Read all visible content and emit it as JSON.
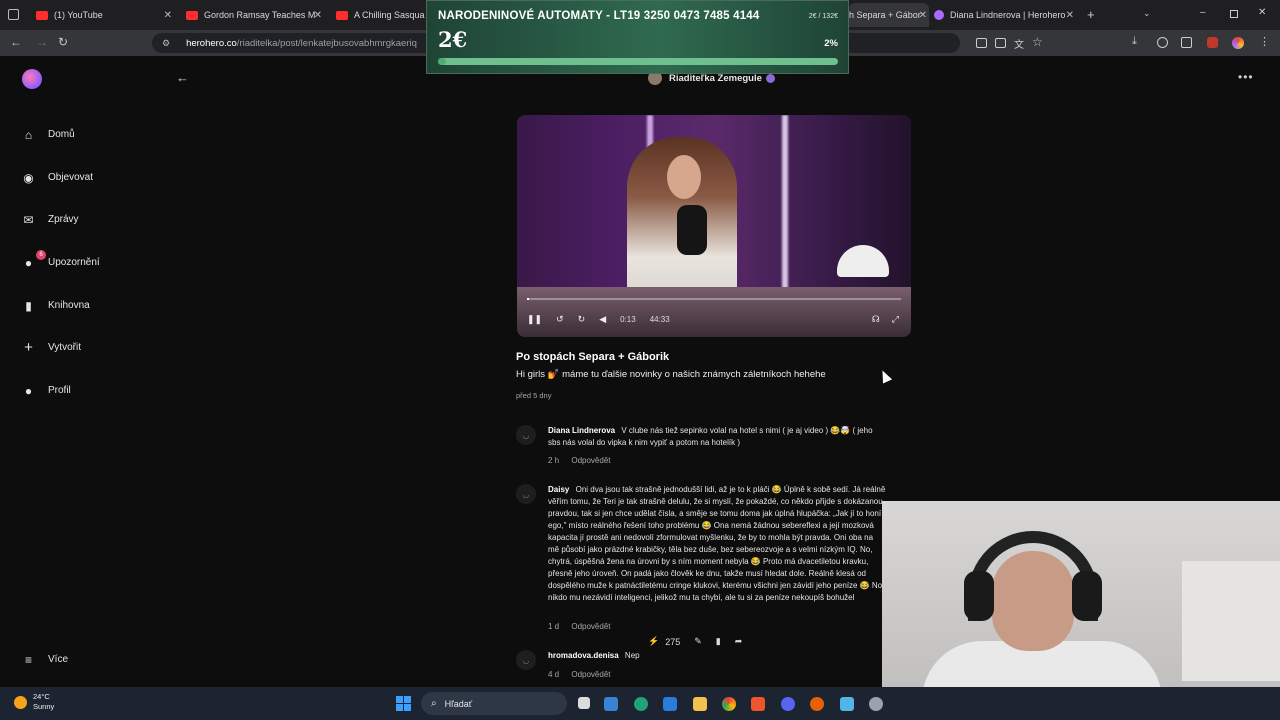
{
  "browser": {
    "tabs": [
      {
        "label": "(1) YouTube",
        "color": "#ff2d2d"
      },
      {
        "label": "Gordon Ramsay Teaches M",
        "color": "#ff2d2d"
      },
      {
        "label": "A Chilling Sasqua",
        "color": "#ff2d2d"
      },
      {
        "label": "h Separa + Gábor",
        "color": "#a86bff"
      },
      {
        "label": "Diana Lindnerova | Herohero",
        "color": "#a86bff"
      }
    ],
    "url_host": "herohero.co",
    "url_path": "/riaditelka/post/lenkatejbusovabhmrgkaeriq"
  },
  "banner": {
    "title": "NARODENINOVÉ AUTOMATY - LT19 3250 0473 7485 4144",
    "amount": "2€",
    "goal": "2€ / 132€",
    "percent_label": "2%",
    "percent": 2
  },
  "sidebar": {
    "items": [
      {
        "label": "Domů",
        "icon": "home-icon"
      },
      {
        "label": "Objevovat",
        "icon": "compass-icon"
      },
      {
        "label": "Zprávy",
        "icon": "mail-icon"
      },
      {
        "label": "Upozornění",
        "icon": "bell-icon",
        "badge": "6"
      },
      {
        "label": "Knihovna",
        "icon": "bookmark-icon"
      },
      {
        "label": "Vytvořit",
        "icon": "plus-icon"
      },
      {
        "label": "Profil",
        "icon": "user-icon"
      }
    ],
    "more": "Více"
  },
  "author": {
    "name": "Riaditeľka Zemegule"
  },
  "video": {
    "time": "0:13",
    "duration": "44:33",
    "progress": 0.005
  },
  "post": {
    "title": "Po stopách Separa + Gáborik",
    "text": "Hi girls 💅 máme tu ďalšie novinky o našich známych záletníkoch hehehe",
    "date": "před 5 dny"
  },
  "comments": [
    {
      "name": "Diana Lindnerova",
      "text": "V clube nás tiež sepinko volal na hotel s nimi ( je aj video ) 😂🤯 ( jeho sbs nás volal do vipka k nim vypiť a potom na hotelík )",
      "age": "2 h",
      "reply": "Odpovědět"
    },
    {
      "name": "Daisy",
      "text": "Oni dva jsou tak strašně jednodušší lidi, až je to k pláči 😂 Úplně k sobě sedí. Já reálně věřím tomu, že Teri je tak strašně delulu, že si myslí, že pokaždé, co někdo přijde s dokázanou pravdou, tak si jen chce udělat čísla, a směje se tomu doma jak úplná hlupáčka: „Jak jí to honí ego,\" místo reálného řešení toho problému 😂 Ona nemá žádnou sebereflexi a její mozková kapacita jí prostě ani nedovolí zformulovat myšlenku, že by to mohla být pravda. Oni oba na mě působí jako prázdné krabičky, těla bez duše, bez sebereozvoje a s velmi nízkým IQ. No, chytrá, úspěšná žena na úrovni by s ním moment nebyla 😂 Proto má dvacetiletou kravku, přesně jeho úroveň. On padá jako člověk ke dnu, takže musí hledat dole. Reálně klesá od dospělého muže k patnáctiletému cringe klukovi, kterému všichni jen závidí jeho peníze 😂 No, nikdo mu nezávidí inteligenci, jelikož mu ta chybí, ale tu si za peníze nekoupíš bohužel",
      "age": "1 d",
      "reply": "Odpovědět"
    },
    {
      "name": "hromadova.denisa",
      "text": "Nep",
      "age": "4 d",
      "reply": "Odpovědět"
    }
  ],
  "actions": {
    "likes": "275"
  },
  "taskbar": {
    "temperature": "24°C",
    "condition": "Sunny",
    "search_placeholder": "Hľadať"
  }
}
